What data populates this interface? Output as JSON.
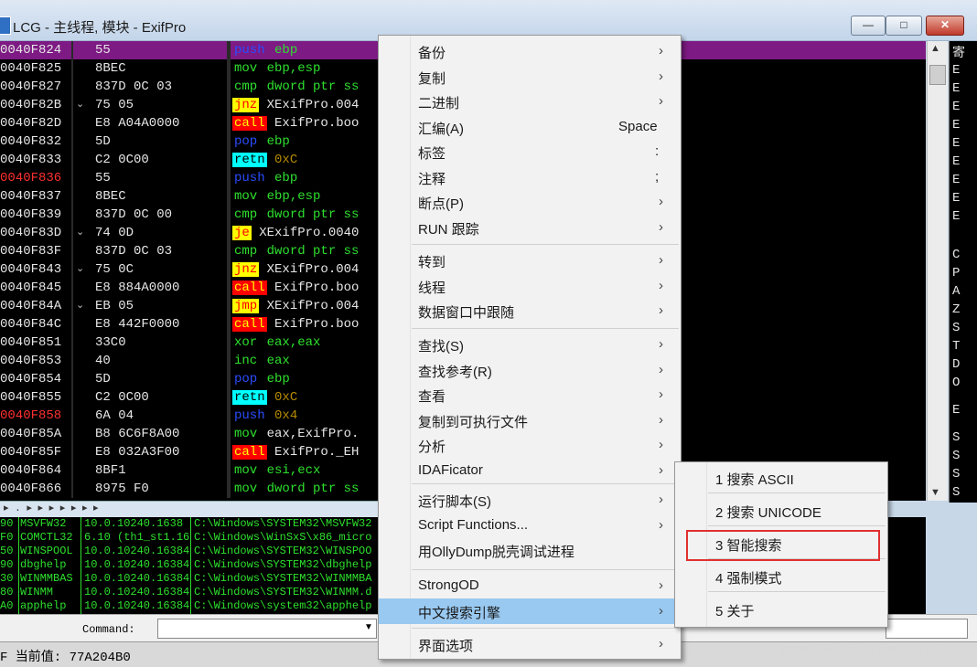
{
  "window": {
    "title": "LCG - 主线程, 模块 - ExifPro",
    "minimize_label": "—",
    "maximize_label": "□",
    "close_label": "✕"
  },
  "disasm": [
    {
      "addr": "0040F824",
      "arrow": "",
      "hex": "55",
      "mn": "push",
      "mclass": "push",
      "ops": [
        [
          "ebp",
          "g"
        ]
      ],
      "sel": true,
      "addr_red": false
    },
    {
      "addr": "0040F825",
      "arrow": "",
      "hex": "8BEC",
      "mn": "mov",
      "mclass": "mov",
      "ops": [
        [
          "ebp,esp",
          "g"
        ]
      ]
    },
    {
      "addr": "0040F827",
      "arrow": "",
      "hex": "837D 0C 03",
      "mn": "cmp",
      "mclass": "cmp",
      "ops": [
        [
          "dword ptr ss",
          "g"
        ]
      ]
    },
    {
      "addr": "0040F82B",
      "arrow": "⌄",
      "hex": "75 05",
      "mn": "jnz",
      "mclass": "jnz",
      "ops": [
        [
          "XExifPro.004",
          "w"
        ]
      ]
    },
    {
      "addr": "0040F82D",
      "arrow": "",
      "hex": "E8 A04A0000",
      "mn": "call",
      "mclass": "call",
      "ops": [
        [
          "ExifPro.boo",
          "w"
        ]
      ]
    },
    {
      "addr": "0040F832",
      "arrow": "",
      "hex": "5D",
      "mn": "pop",
      "mclass": "pop",
      "ops": [
        [
          "ebp",
          "g"
        ]
      ]
    },
    {
      "addr": "0040F833",
      "arrow": "",
      "hex": "C2 0C00",
      "mn": "retn",
      "mclass": "retn",
      "ops": [
        [
          "0xC",
          "o"
        ]
      ]
    },
    {
      "addr": "0040F836",
      "arrow": "",
      "hex": "55",
      "mn": "push",
      "mclass": "push",
      "ops": [
        [
          "ebp",
          "g"
        ]
      ],
      "addr_red": true
    },
    {
      "addr": "0040F837",
      "arrow": "",
      "hex": "8BEC",
      "mn": "mov",
      "mclass": "mov",
      "ops": [
        [
          "ebp,esp",
          "g"
        ]
      ]
    },
    {
      "addr": "0040F839",
      "arrow": "",
      "hex": "837D 0C 00",
      "mn": "cmp",
      "mclass": "cmp",
      "ops": [
        [
          "dword ptr ss",
          "g"
        ]
      ]
    },
    {
      "addr": "0040F83D",
      "arrow": "⌄",
      "hex": "74 0D",
      "mn": "je",
      "mclass": "je",
      "ops": [
        [
          "XExifPro.0040",
          "w"
        ]
      ]
    },
    {
      "addr": "0040F83F",
      "arrow": "",
      "hex": "837D 0C 03",
      "mn": "cmp",
      "mclass": "cmp",
      "ops": [
        [
          "dword ptr ss",
          "g"
        ]
      ]
    },
    {
      "addr": "0040F843",
      "arrow": "⌄",
      "hex": "75 0C",
      "mn": "jnz",
      "mclass": "jnz",
      "ops": [
        [
          "XExifPro.004",
          "w"
        ]
      ]
    },
    {
      "addr": "0040F845",
      "arrow": "",
      "hex": "E8 884A0000",
      "mn": "call",
      "mclass": "call",
      "ops": [
        [
          "ExifPro.boo",
          "w"
        ]
      ]
    },
    {
      "addr": "0040F84A",
      "arrow": "⌄",
      "hex": "EB 05",
      "mn": "jmp",
      "mclass": "jmp",
      "ops": [
        [
          "XExifPro.004",
          "w"
        ]
      ]
    },
    {
      "addr": "0040F84C",
      "arrow": "",
      "hex": "E8 442F0000",
      "mn": "call",
      "mclass": "call",
      "ops": [
        [
          "ExifPro.boo",
          "w"
        ]
      ]
    },
    {
      "addr": "0040F851",
      "arrow": "",
      "hex": "33C0",
      "mn": "xor",
      "mclass": "xor",
      "ops": [
        [
          "eax,eax",
          "g"
        ]
      ]
    },
    {
      "addr": "0040F853",
      "arrow": "",
      "hex": "40",
      "mn": "inc",
      "mclass": "inc",
      "ops": [
        [
          "eax",
          "g"
        ]
      ]
    },
    {
      "addr": "0040F854",
      "arrow": "",
      "hex": "5D",
      "mn": "pop",
      "mclass": "pop",
      "ops": [
        [
          "ebp",
          "g"
        ]
      ]
    },
    {
      "addr": "0040F855",
      "arrow": "",
      "hex": "C2 0C00",
      "mn": "retn",
      "mclass": "retn",
      "ops": [
        [
          "0xC",
          "o"
        ]
      ]
    },
    {
      "addr": "0040F858",
      "arrow": "",
      "hex": "6A 04",
      "mn": "push",
      "mclass": "push",
      "ops": [
        [
          "0x4",
          "o"
        ]
      ],
      "addr_red": true
    },
    {
      "addr": "0040F85A",
      "arrow": "",
      "hex": "B8 6C6F8A00",
      "mn": "mov",
      "mclass": "mov",
      "ops": [
        [
          "eax,ExifPro.",
          "w"
        ]
      ]
    },
    {
      "addr": "0040F85F",
      "arrow": "",
      "hex": "E8 032A3F00",
      "mn": "call",
      "mclass": "call",
      "ops": [
        [
          "ExifPro._EH",
          "w"
        ]
      ]
    },
    {
      "addr": "0040F864",
      "arrow": "",
      "hex": "8BF1",
      "mn": "mov",
      "mclass": "mov",
      "ops": [
        [
          "esi,ecx",
          "g"
        ]
      ]
    },
    {
      "addr": "0040F866",
      "arrow": "",
      "hex": "8975 F0",
      "mn": "mov",
      "mclass": "mov",
      "ops": [
        [
          "dword ptr ss",
          "g"
        ]
      ]
    }
  ],
  "registers": {
    "header": "寄",
    "letters": [
      "E",
      "E",
      "E",
      "E",
      "E",
      "E",
      "E",
      "E",
      "E",
      "C",
      "P",
      "A",
      "Z",
      "S",
      "T",
      "D",
      "O",
      "E",
      "S",
      "S",
      "S",
      "S"
    ]
  },
  "splitter_text": "▸ .  ▸ ▸ ▸ ▸ ▸ ▸ ▸",
  "modules": [
    {
      "base": "90",
      "name": "MSVFW32",
      "ver": "10.0.10240.1638",
      "path": "C:\\Windows\\SYSTEM32\\MSVFW32"
    },
    {
      "base": "F0",
      "name": "COMCTL32",
      "ver": "6.10 (th1_st1.16",
      "path": "C:\\Windows\\WinSxS\\x86_micro"
    },
    {
      "base": "50",
      "name": "WINSPOOL",
      "ver": "10.0.10240.16384",
      "path": "C:\\Windows\\SYSTEM32\\WINSPOO"
    },
    {
      "base": "90",
      "name": "dbghelp",
      "ver": "10.0.10240.16384",
      "path": "C:\\Windows\\SYSTEM32\\dbghelp"
    },
    {
      "base": "30",
      "name": "WINMMBAS",
      "ver": "10.0.10240.16384",
      "path": "C:\\Windows\\SYSTEM32\\WINMMBA"
    },
    {
      "base": "80",
      "name": "WINMM",
      "ver": "10.0.10240.16384",
      "path": "C:\\Windows\\SYSTEM32\\WINMM.d"
    },
    {
      "base": "A0",
      "name": "apphelp",
      "ver": "10.0.10240.16384",
      "path": "C:\\Windows\\system32\\apphelp"
    }
  ],
  "command": {
    "label": "Command:",
    "value": "",
    "dropdown": "▼"
  },
  "status": {
    "text": "F 当前值: 77A204B0"
  },
  "watermark": "https://blog.csdn.net/AC1145",
  "context_menu": {
    "groups": [
      [
        {
          "label": "备份",
          "shortcut": "",
          "arrow": "›"
        },
        {
          "label": "复制",
          "shortcut": "",
          "arrow": "›"
        },
        {
          "label": "二进制",
          "shortcut": "",
          "arrow": "›"
        },
        {
          "label": "汇编(A)",
          "shortcut": "Space",
          "arrow": ""
        },
        {
          "label": "标签",
          "shortcut": ":",
          "arrow": ""
        },
        {
          "label": "注释",
          "shortcut": ";",
          "arrow": ""
        },
        {
          "label": "断点(P)",
          "shortcut": "",
          "arrow": "›"
        },
        {
          "label": "RUN 跟踪",
          "shortcut": "",
          "arrow": "›"
        }
      ],
      [
        {
          "label": "转到",
          "shortcut": "",
          "arrow": "›"
        },
        {
          "label": "线程",
          "shortcut": "",
          "arrow": "›"
        },
        {
          "label": "数据窗口中跟随",
          "shortcut": "",
          "arrow": "›"
        }
      ],
      [
        {
          "label": "查找(S)",
          "shortcut": "",
          "arrow": "›"
        },
        {
          "label": "查找参考(R)",
          "shortcut": "",
          "arrow": "›"
        },
        {
          "label": "查看",
          "shortcut": "",
          "arrow": "›"
        },
        {
          "label": "复制到可执行文件",
          "shortcut": "",
          "arrow": "›"
        },
        {
          "label": "分析",
          "shortcut": "",
          "arrow": "›"
        },
        {
          "label": "IDAFicator",
          "shortcut": "",
          "arrow": "›"
        }
      ],
      [
        {
          "label": "运行脚本(S)",
          "shortcut": "",
          "arrow": "›"
        },
        {
          "label": "Script Functions...",
          "shortcut": "",
          "arrow": "›"
        },
        {
          "label": "用OllyDump脱壳调试进程",
          "shortcut": "",
          "arrow": ""
        }
      ],
      [
        {
          "label": "StrongOD",
          "shortcut": "",
          "arrow": "›"
        },
        {
          "label": "中文搜索引擎",
          "shortcut": "",
          "arrow": "›",
          "highlighted": true
        }
      ],
      [
        {
          "label": "界面选项",
          "shortcut": "",
          "arrow": "›"
        }
      ]
    ]
  },
  "submenu": {
    "items": [
      {
        "label": "1 搜索 ASCII"
      },
      {
        "label": "2 搜索 UNICODE"
      },
      {
        "label": "3 智能搜索",
        "marked": true
      },
      {
        "label": "4 强制模式"
      },
      {
        "label": "5 关于"
      }
    ]
  },
  "colors": {
    "selection": "#7d1a83",
    "menu_highlight": "#99c9f1",
    "annotation_box": "#e03030"
  }
}
